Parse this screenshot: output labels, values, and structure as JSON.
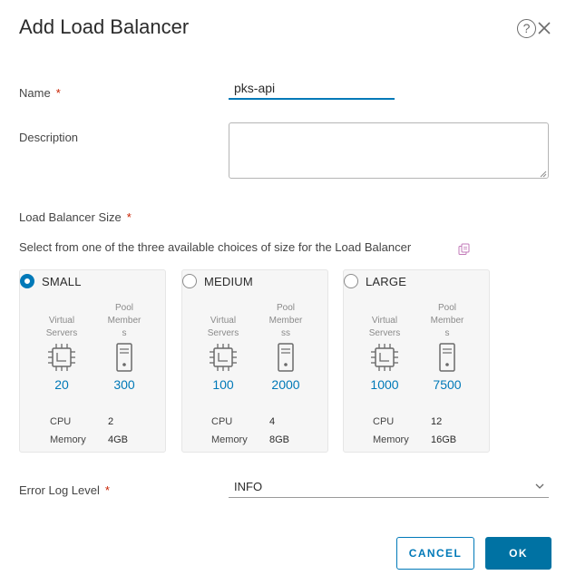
{
  "dialog": {
    "title": "Add Load Balancer",
    "help_glyph": "?",
    "close_glyph": "✕"
  },
  "form": {
    "name_label": "Name",
    "required_mark": "*",
    "name_value": "pks-api",
    "description_label": "Description",
    "description_value": "",
    "size_label": "Load Balancer Size",
    "size_help": "Select from one of the three available choices of size for the Load Balancer",
    "error_log_label": "Error Log Level",
    "error_log_value": "INFO"
  },
  "sizes": [
    {
      "name": "SMALL",
      "selected": true,
      "virtual_label": "Virtual\nServers",
      "pool_label": "Pool\nMember\ns",
      "virtual_servers": "20",
      "pool_members": "300",
      "cpu_label": "CPU",
      "cpu": "2",
      "memory_label": "Memory",
      "memory": "4GB"
    },
    {
      "name": "MEDIUM",
      "selected": false,
      "virtual_label": "Virtual\nServers",
      "pool_label": "Pool\nMember\nss",
      "virtual_servers": "100",
      "pool_members": "2000",
      "cpu_label": "CPU",
      "cpu": "4",
      "memory_label": "Memory",
      "memory": "8GB"
    },
    {
      "name": "LARGE",
      "selected": false,
      "virtual_label": "Virtual\nServers",
      "pool_label": "Pool\nMember\ns",
      "virtual_servers": "1000",
      "pool_members": "7500",
      "cpu_label": "CPU",
      "cpu": "12",
      "memory_label": "Memory",
      "memory": "16GB"
    }
  ],
  "actions": {
    "cancel": "CANCEL",
    "ok": "OK"
  },
  "colors": {
    "accent": "#0079b8",
    "required": "#c92100",
    "primary_button": "#0072a3"
  },
  "icons": [
    "help-icon",
    "close-icon",
    "copy-icon",
    "cpu-chip-icon",
    "server-icon",
    "chevron-down-icon"
  ]
}
